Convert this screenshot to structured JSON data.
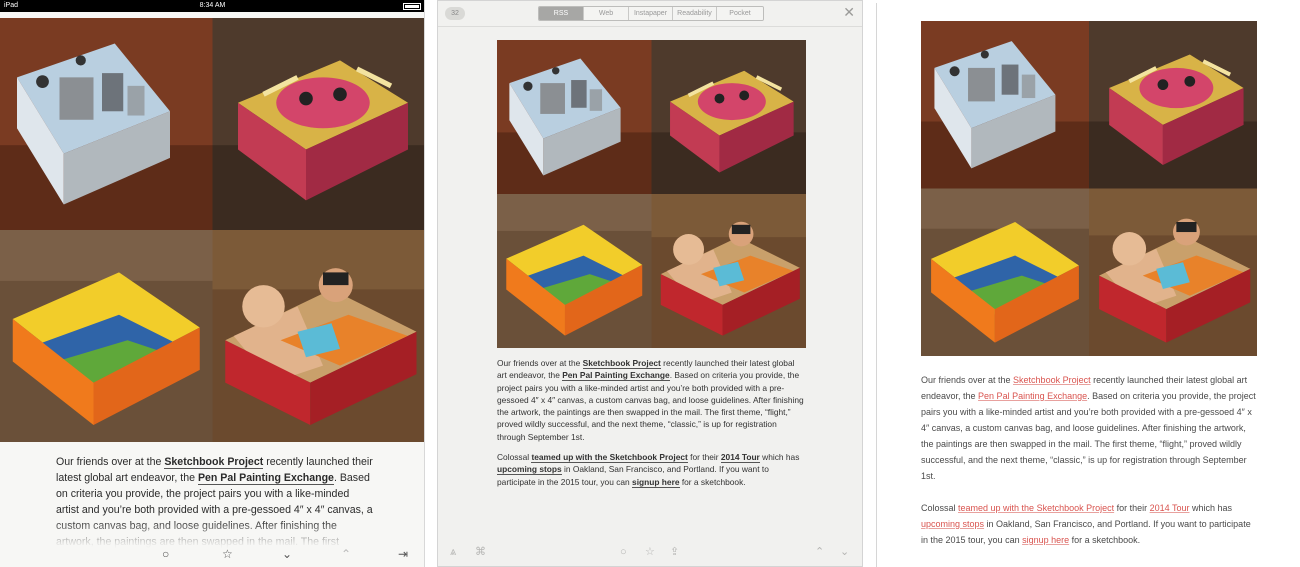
{
  "status_bar": {
    "carrier": "iPad",
    "time": "8:34 AM"
  },
  "reeder": {
    "unread_count": "32",
    "tabs": [
      "RSS",
      "Web",
      "Instapaper",
      "Readability",
      "Pocket"
    ],
    "active_tab": "RSS"
  },
  "article": {
    "p1": {
      "t1": "Our friends over at the ",
      "l1": "Sketchbook Project",
      "t2": " recently launched their latest global art endeavor, the ",
      "l2": "Pen Pal Painting Exchange",
      "t3": ". Based on criteria you provide, the project pairs you with a like-minded artist and you’re both provided with a pre-gessoed 4″ x 4″ canvas, a custom canvas bag, and loose guidelines. After finishing the artwork, the paintings are then swapped in the mail. The first theme, “flight,” proved wildly successful, and the next theme, “classic,” is up for registration through September 1st."
    },
    "p2": {
      "t1": "Colossal ",
      "l1": "teamed up with the Sketchbook Project",
      "t2": " for their ",
      "l2": "2014 Tour",
      "t3": " which has ",
      "l3": "upcoming stops",
      "t4": " in Oakland, San Francisco, and Portland. If you want to participate in the 2015 tour, you can ",
      "l4": "signup here",
      "t5": " for a sketchbook."
    }
  },
  "ipad_article_truncated": {
    "t1": "Our friends over at the ",
    "l1": "Sketchbook Project",
    "t2": " recently launched their latest global art endeavor, the ",
    "l2": "Pen Pal Painting Exchange",
    "t3": ". Based on criteria you provide, the project pairs you with a like-minded artist and you’re both provided with a pre-gessoed 4″ x 4″ canvas, a custom canvas bag, and loose guidelines. After finishing the artwork, the paintings are then swapped in the mail. The first"
  },
  "icons": {
    "ipad_toolbar": [
      "circle-icon",
      "star-icon",
      "chevron-down-icon",
      "chevron-up-icon",
      "share-exit-icon"
    ],
    "reeder_bottom": [
      "readability-icon",
      "swipe-icon",
      "circle-icon",
      "star-icon",
      "share-icon",
      "chevron-up-icon",
      "chevron-down-icon"
    ]
  },
  "colors": {
    "link_red": "#d9544f",
    "segment_active": "#a7a7a5"
  }
}
